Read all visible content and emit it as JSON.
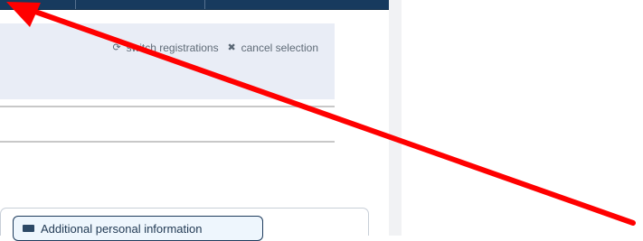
{
  "actions": {
    "switch_registrations": "switch registrations",
    "cancel_selection": "cancel selection"
  },
  "form": {
    "additional_personal_information": "Additional personal information"
  },
  "icons": {
    "switch": "refresh-icon",
    "cancel": "close-icon",
    "personal_information": "card-icon"
  },
  "colors": {
    "navigation": "#173a5e",
    "selection_panel": "#e9edf6",
    "annotation_arrow": "#ff0000"
  }
}
